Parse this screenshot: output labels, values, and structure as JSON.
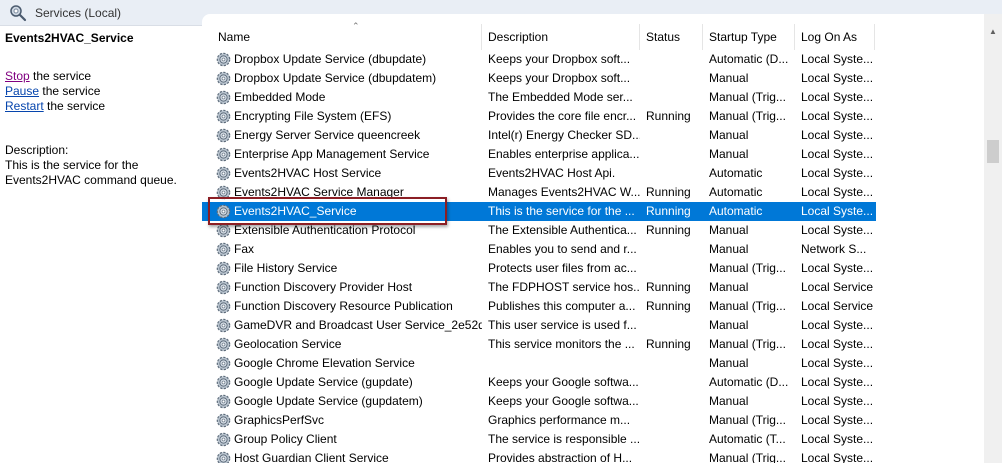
{
  "window": {
    "title": "Services (Local)",
    "title_icon": "magnifier-gear-icon"
  },
  "left_pane": {
    "service_name": "Events2HVAC_Service",
    "actions": [
      {
        "link": "Stop",
        "rest": " the service"
      },
      {
        "link": "Pause",
        "rest": " the service"
      },
      {
        "link": "Restart",
        "rest": " the service"
      }
    ],
    "description_label": "Description:",
    "description_text": "This is the service for the Events2HVAC command queue."
  },
  "columns": {
    "name": "Name",
    "description": "Description",
    "status": "Status",
    "startup_type": "Startup Type",
    "log_on_as": "Log On As"
  },
  "rows": [
    {
      "name": "Dropbox Update Service (dbupdate)",
      "description": "Keeps your Dropbox soft...",
      "status": "",
      "startup": "Automatic (D...",
      "logon": "Local Syste..."
    },
    {
      "name": "Dropbox Update Service (dbupdatem)",
      "description": "Keeps your Dropbox soft...",
      "status": "",
      "startup": "Manual",
      "logon": "Local Syste..."
    },
    {
      "name": "Embedded Mode",
      "description": "The Embedded Mode ser...",
      "status": "",
      "startup": "Manual (Trig...",
      "logon": "Local Syste..."
    },
    {
      "name": "Encrypting File System (EFS)",
      "description": "Provides the core file encr...",
      "status": "Running",
      "startup": "Manual (Trig...",
      "logon": "Local Syste..."
    },
    {
      "name": "Energy Server Service queencreek",
      "description": "Intel(r) Energy Checker SD...",
      "status": "",
      "startup": "Manual",
      "logon": "Local Syste..."
    },
    {
      "name": "Enterprise App Management Service",
      "description": "Enables enterprise applica...",
      "status": "",
      "startup": "Manual",
      "logon": "Local Syste..."
    },
    {
      "name": "Events2HVAC Host Service",
      "description": "Events2HVAC Host Api.",
      "status": "",
      "startup": "Automatic",
      "logon": "Local Syste..."
    },
    {
      "name": "Events2HVAC Service Manager",
      "description": "Manages Events2HVAC W...",
      "status": "Running",
      "startup": "Automatic",
      "logon": "Local Syste..."
    },
    {
      "name": "Events2HVAC_Service",
      "description": "This is the service for the ...",
      "status": "Running",
      "startup": "Automatic",
      "logon": "Local Syste..."
    },
    {
      "name": "Extensible Authentication Protocol",
      "description": "The Extensible Authentica...",
      "status": "Running",
      "startup": "Manual",
      "logon": "Local Syste..."
    },
    {
      "name": "Fax",
      "description": "Enables you to send and r...",
      "status": "",
      "startup": "Manual",
      "logon": "Network S..."
    },
    {
      "name": "File History Service",
      "description": "Protects user files from ac...",
      "status": "",
      "startup": "Manual (Trig...",
      "logon": "Local Syste..."
    },
    {
      "name": "Function Discovery Provider Host",
      "description": "The FDPHOST service hos...",
      "status": "Running",
      "startup": "Manual",
      "logon": "Local Service"
    },
    {
      "name": "Function Discovery Resource Publication",
      "description": "Publishes this computer a...",
      "status": "Running",
      "startup": "Manual (Trig...",
      "logon": "Local Service"
    },
    {
      "name": "GameDVR and Broadcast User Service_2e52db",
      "description": "This user service is used f...",
      "status": "",
      "startup": "Manual",
      "logon": "Local Syste..."
    },
    {
      "name": "Geolocation Service",
      "description": "This service monitors the ...",
      "status": "Running",
      "startup": "Manual (Trig...",
      "logon": "Local Syste..."
    },
    {
      "name": "Google Chrome Elevation Service",
      "description": "",
      "status": "",
      "startup": "Manual",
      "logon": "Local Syste..."
    },
    {
      "name": "Google Update Service (gupdate)",
      "description": "Keeps your Google softwa...",
      "status": "",
      "startup": "Automatic (D...",
      "logon": "Local Syste..."
    },
    {
      "name": "Google Update Service (gupdatem)",
      "description": "Keeps your Google softwa...",
      "status": "",
      "startup": "Manual",
      "logon": "Local Syste..."
    },
    {
      "name": "GraphicsPerfSvc",
      "description": "Graphics performance m...",
      "status": "",
      "startup": "Manual (Trig...",
      "logon": "Local Syste..."
    },
    {
      "name": "Group Policy Client",
      "description": "The service is responsible ...",
      "status": "",
      "startup": "Automatic (T...",
      "logon": "Local Syste..."
    },
    {
      "name": "Host Guardian Client Service",
      "description": "Provides abstraction of H...",
      "status": "",
      "startup": "Manual (Trig...",
      "logon": "Local Syste..."
    }
  ],
  "selected_row": 8,
  "colors": {
    "selection": "#0078d7",
    "highlight_box": "#8b1e24",
    "link": "#800080"
  },
  "row_icon": "service-gear-icon"
}
